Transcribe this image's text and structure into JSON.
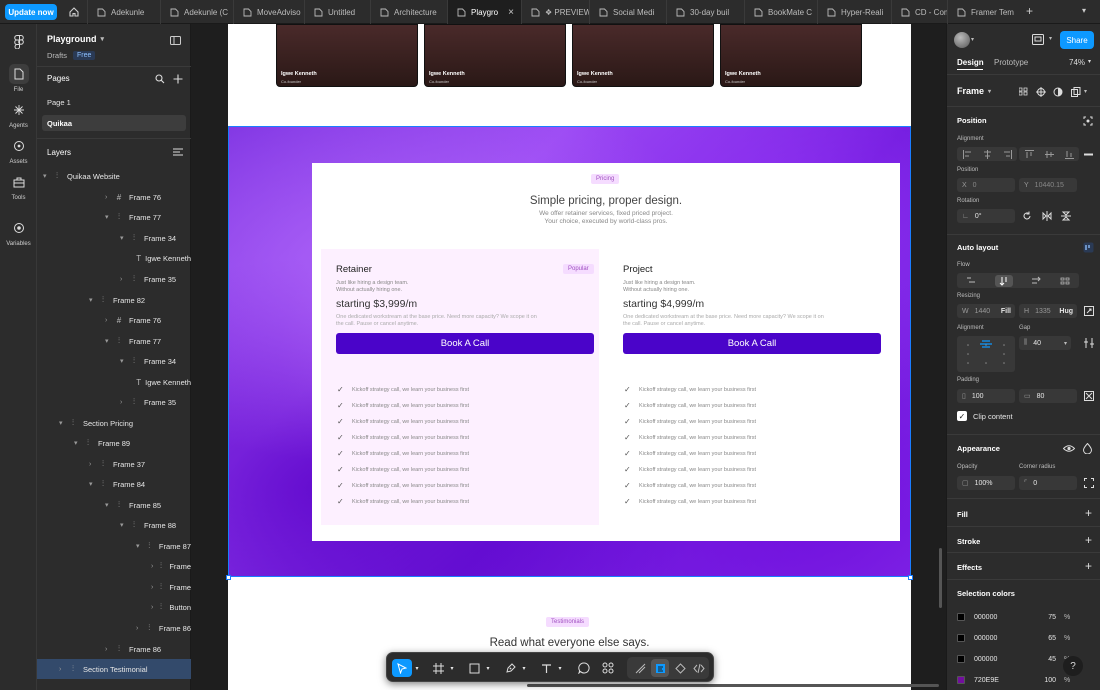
{
  "topbar": {
    "update_label": "Update now",
    "tabs": [
      {
        "label": "Adekunle"
      },
      {
        "label": "Adekunle (C"
      },
      {
        "label": "MoveAdviso"
      },
      {
        "label": "Untitled"
      },
      {
        "label": "Architecture"
      },
      {
        "label": "Playgro"
      },
      {
        "label": "❖ PREVIEW"
      },
      {
        "label": "Social Medi"
      },
      {
        "label": "30-day buil"
      },
      {
        "label": "BookMate C"
      },
      {
        "label": "Hyper-Reali"
      },
      {
        "label": "CD - Compa"
      },
      {
        "label": "Framer Tem"
      }
    ]
  },
  "rail": {
    "file": "File",
    "agents": "Agents",
    "assets": "Assets",
    "tools": "Tools",
    "variables": "Variables"
  },
  "layers_panel": {
    "file_name": "Playground",
    "drafts": "Drafts",
    "plan_badge": "Free",
    "pages_title": "Pages",
    "pages": [
      "Page 1",
      "Quikaa"
    ],
    "layers_title": "Layers",
    "rows": [
      {
        "label": "Quikaa Website",
        "icon": "frame-icon"
      },
      {
        "label": "Frame 76",
        "icon": "grid-icon"
      },
      {
        "label": "Frame 77",
        "icon": "frame-icon"
      },
      {
        "label": "Frame 34",
        "icon": "frame-icon"
      },
      {
        "label": "Igwe Kenneth",
        "icon": "text-icon"
      },
      {
        "label": "Frame 35",
        "icon": "frame-icon"
      },
      {
        "label": "Frame 82",
        "icon": "frame-icon"
      },
      {
        "label": "Frame 76",
        "icon": "grid-icon"
      },
      {
        "label": "Frame 77",
        "icon": "frame-icon"
      },
      {
        "label": "Frame 34",
        "icon": "frame-icon"
      },
      {
        "label": "Igwe Kenneth",
        "icon": "text-icon"
      },
      {
        "label": "Frame 35",
        "icon": "frame-icon"
      },
      {
        "label": "Section Pricing",
        "icon": "frame-icon"
      },
      {
        "label": "Frame 89",
        "icon": "frame-icon"
      },
      {
        "label": "Frame 37",
        "icon": "frame-icon"
      },
      {
        "label": "Frame 84",
        "icon": "frame-icon"
      },
      {
        "label": "Frame 85",
        "icon": "frame-icon"
      },
      {
        "label": "Frame 88",
        "icon": "frame-icon"
      },
      {
        "label": "Frame 87",
        "icon": "frame-icon"
      },
      {
        "label": "Frame",
        "icon": "frame-icon"
      },
      {
        "label": "Frame",
        "icon": "frame-icon"
      },
      {
        "label": "Button",
        "icon": "frame-icon"
      },
      {
        "label": "Frame 86",
        "icon": "frame-icon"
      },
      {
        "label": "Frame 86",
        "icon": "frame-icon"
      },
      {
        "label": "Section Testimonial",
        "icon": "frame-icon"
      }
    ]
  },
  "canvas": {
    "team": [
      {
        "name": "Igwe Kenneth",
        "role": "Co-founder"
      },
      {
        "name": "Igwe Kenneth",
        "role": "Co-founder"
      },
      {
        "name": "Igwe Kenneth",
        "role": "Co-founder"
      },
      {
        "name": "Igwe Kenneth",
        "role": "Co-founder"
      }
    ],
    "pricing": {
      "pill": "Pricing",
      "title": "Simple pricing, proper design.",
      "subtitle_1": "We offer retainer services, fixed priced project.",
      "subtitle_2": "Your choice, executed by world-class pros.",
      "plans": [
        {
          "name": "Retainer",
          "badge": "Popular",
          "desc_1": "Just like hiring a design team.",
          "desc_2": "Without actually hiring one.",
          "price": "starting $3,999/m",
          "note_1": "One dedicated workstream at the base price. Need more capacity? We scope it on",
          "note_2": "the call. Pause or cancel anytime.",
          "cta": "Book A Call"
        },
        {
          "name": "Project",
          "badge": "",
          "desc_1": "Just like hiring a design team.",
          "desc_2": "Without actually hiring one.",
          "price": "starting $4,999/m",
          "note_1": "One dedicated workstream at the base price. Need more capacity? We scope it on",
          "note_2": "the call. Pause or cancel anytime.",
          "cta": "Book A Call"
        }
      ],
      "feature": "Kickoff strategy call, we learn your business first"
    },
    "testimonials": {
      "pill": "Testimonials",
      "title": "Read what everyone else says."
    }
  },
  "props": {
    "share": "Share",
    "tab_design": "Design",
    "tab_prototype": "Prototype",
    "zoom": "74%",
    "frame_label": "Frame",
    "position": "Position",
    "alignment": "Alignment",
    "position_label": "Position",
    "x_key": "X",
    "x_val": "0",
    "y_key": "Y",
    "y_val": "10440.15",
    "rotation": "Rotation",
    "rotation_val": "0°",
    "auto_layout": "Auto layout",
    "flow": "Flow",
    "resizing": "Resizing",
    "w_key": "W",
    "w_val": "1440",
    "w_mode": "Fill",
    "h_key": "H",
    "h_val": "1335",
    "h_mode": "Hug",
    "alignment2": "Alignment",
    "gap": "Gap",
    "gap_val": "40",
    "padding": "Padding",
    "pad_h": "100",
    "pad_v": "80",
    "clip": "Clip content",
    "appearance": "Appearance",
    "opacity": "Opacity",
    "opacity_val": "100%",
    "corner": "Corner radius",
    "corner_val": "0",
    "fill": "Fill",
    "stroke": "Stroke",
    "effects": "Effects",
    "selection_colors": "Selection colors",
    "colors": [
      {
        "hex": "000000",
        "pct": "75",
        "unit": "%",
        "color": "#000000"
      },
      {
        "hex": "000000",
        "pct": "65",
        "unit": "%",
        "color": "#000000"
      },
      {
        "hex": "000000",
        "pct": "45",
        "unit": "%",
        "color": "#000000"
      },
      {
        "hex": "720E9E",
        "pct": "100",
        "unit": "%",
        "color": "#720E9E"
      }
    ],
    "help": "?"
  }
}
